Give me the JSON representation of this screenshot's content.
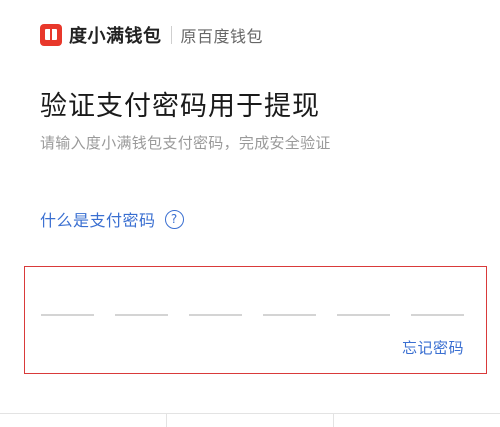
{
  "header": {
    "brand": "度小满钱包",
    "brand_sub": "原百度钱包",
    "logo_icon": "wallet-logo-icon",
    "logo_color": "#e8382b"
  },
  "main": {
    "title": "验证支付密码用于提现",
    "subtitle": "请输入度小满钱包支付密码，完成安全验证",
    "help_link": "什么是支付密码",
    "help_icon_glyph": "?",
    "forgot_password": "忘记密码",
    "password_digits": 6
  },
  "colors": {
    "accent": "#3a6fd1",
    "highlight_border": "#d93a3a"
  }
}
